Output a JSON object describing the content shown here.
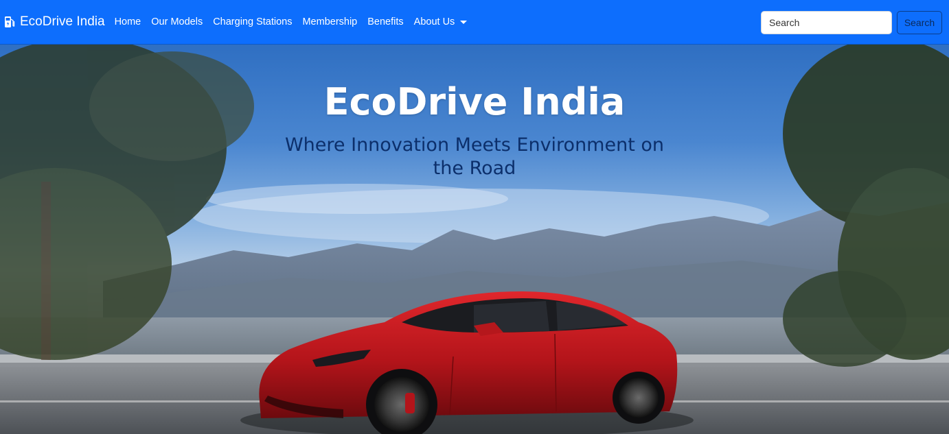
{
  "navbar": {
    "brand": "EcoDrive India",
    "brand_icon": "ev-charger-icon",
    "links": [
      {
        "label": "Home"
      },
      {
        "label": "Our Models"
      },
      {
        "label": "Charging Stations"
      },
      {
        "label": "Membership"
      },
      {
        "label": "Benefits"
      },
      {
        "label": "About Us"
      }
    ],
    "search_placeholder": "Search",
    "search_button": "Search"
  },
  "hero": {
    "title": "EcoDrive India",
    "subtitle": "Where Innovation Meets Environment on the Road"
  },
  "colors": {
    "navbar_bg": "#0d6efd",
    "subtitle": "#0c2f6b",
    "car": "#c0171d"
  }
}
